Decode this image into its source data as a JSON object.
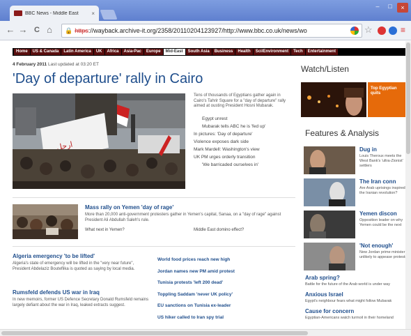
{
  "browser": {
    "tab_title": "BBC News - Middle East",
    "tab_close": "×",
    "window_controls": [
      "–",
      "□",
      "×"
    ],
    "nav": {
      "back": "←",
      "forward": "→",
      "reload": "C",
      "home": "⌂"
    },
    "url_scheme": "https",
    "url_rest": "://wayback.archive-it.org/2358/20110204123927/http://www.bbc.co.uk/news/wo",
    "star": "☆",
    "menu": "≡"
  },
  "navbar": {
    "items": [
      "Home",
      "US & Canada",
      "Latin America",
      "UK",
      "Africa",
      "Asia-Pac",
      "Europe",
      "Mid-East",
      "South Asia",
      "Business",
      "Health",
      "Sci/Environment",
      "Tech",
      "Entertainment"
    ],
    "active": "Mid-East"
  },
  "article": {
    "date": "4 February 2011",
    "updated": " Last updated at 03:20 ET",
    "headline": "'Day of departure' rally in Cairo",
    "summary": "Tens of thousands of Egyptians gather again in Cairo's Tahrir Square for a \"day of departure\" rally aimed at ousting President Hosni Mubarak.",
    "links": [
      {
        "text": "Egypt unrest",
        "indent": true
      },
      {
        "text": "Mubarak tells ABC he is 'fed up'",
        "indent": true
      },
      {
        "text": "In pictures: 'Day of departure'",
        "indent": false
      },
      {
        "text": "Violence exposes dark side",
        "indent": false
      },
      {
        "text": "Mark Mardell: Washington's view",
        "indent": false
      },
      {
        "text": "UK PM urges orderly transition",
        "indent": false
      },
      {
        "text": "'We barricaded ourselves in'",
        "indent": true
      }
    ]
  },
  "yemen": {
    "title": "Mass rally on Yemen 'day of rage'",
    "text": "More than 20,000 anti-government protesters gather in Yemen's capital, Sanaa, on a \"day of rage\" against President Ali Abdullah Saleh's rule.",
    "link1": "What next in Yemen?",
    "link2": "Middle East domino effect?"
  },
  "stories": [
    {
      "head": "Algeria emergency 'to be lifted'",
      "text": "Algeria's state of emergency will be lifted in the \"very near future\", President Abdelaziz Bouteflika is quoted as saying by local media."
    },
    {
      "head": "Rumsfeld defends US war in Iraq",
      "text": "In new memoirs, former US Defence Secretary Donald Rumsfeld remains largely defiant about the war in Iraq, leaked extracts suggest."
    }
  ],
  "right_list": [
    "World food prices reach new high",
    "Jordan names new PM amid protest",
    "Tunisia protests 'left 200 dead'",
    "Toppling Saddam 'never UK policy'",
    "EU sanctions on Tunisia ex-leader",
    "US hiker called to Iran spy trial"
  ],
  "sidebar": {
    "watch_title": "Watch/Listen",
    "watch_promo": "Top Egyptian quits",
    "features_title": "Features & Analysis",
    "features": [
      {
        "head": "Dug in",
        "text": "Louis Theroux meets the West Bank's 'ultra-Zionist' settlers"
      },
      {
        "head": "The Iran conn",
        "text": "Are Arab uprisings inspired by the Iranian revolution?"
      },
      {
        "head": "Yemen discon",
        "text": "Opposition leader on why Yemen could be the next"
      },
      {
        "head": "'Not enough'",
        "text": "New Jordan prime minister unlikely to appease protests"
      }
    ],
    "links": [
      {
        "head": "Arab spring?",
        "text": "Battle for the future of the Arab world is under way"
      },
      {
        "head": "Anxious Israel",
        "text": "Egypt's neighbour fears what might follow Mubarak"
      },
      {
        "head": "Cause for concern",
        "text": "Egyptian-Americans watch turmoil in their homeland"
      }
    ]
  },
  "colors": {
    "link_blue": "#1f4e8c",
    "nav_active": "#ffffff",
    "promo_orange": "#e66a0a",
    "chrome_blue": "#6f8fd6"
  }
}
